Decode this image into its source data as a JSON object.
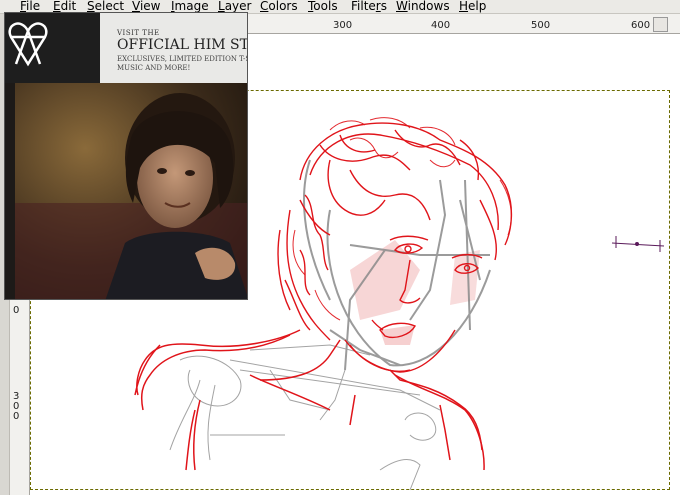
{
  "menubar": {
    "items": [
      {
        "label": "File",
        "accel": "F",
        "rest": "ile"
      },
      {
        "label": "Edit",
        "accel": "E",
        "rest": "dit"
      },
      {
        "label": "Select",
        "accel": "S",
        "rest": "elect"
      },
      {
        "label": "View",
        "accel": "V",
        "rest": "iew"
      },
      {
        "label": "Image",
        "accel": "I",
        "rest": "mage"
      },
      {
        "label": "Layer",
        "accel": "L",
        "rest": "ayer"
      },
      {
        "label": "Colors",
        "accel": "C",
        "rest": "olors"
      },
      {
        "label": "Tools",
        "accel": "T",
        "rest": "ools"
      },
      {
        "label": "Filters",
        "accel": "r",
        "pre": "Filte",
        "rest": "s"
      },
      {
        "label": "Windows",
        "accel": "W",
        "rest": "indows"
      },
      {
        "label": "Help",
        "accel": "H",
        "rest": "elp"
      }
    ]
  },
  "hruler": {
    "labels": [
      "300",
      "400",
      "500",
      "600"
    ]
  },
  "vruler": {
    "labels": [
      "0",
      "300"
    ]
  },
  "reference": {
    "visit": "VISIT THE",
    "title": "OFFICIAL HIM STO",
    "sub1": "EXCLUSIVES, LIMITED EDITION T-SH",
    "sub2": "MUSIC AND MORE!"
  },
  "colors": {
    "sketch_red": "#e0141a",
    "sketch_gray": "#8a8a8a",
    "skin_pink": "#f4c4c4",
    "menubar_bg": "#ebeae6"
  }
}
